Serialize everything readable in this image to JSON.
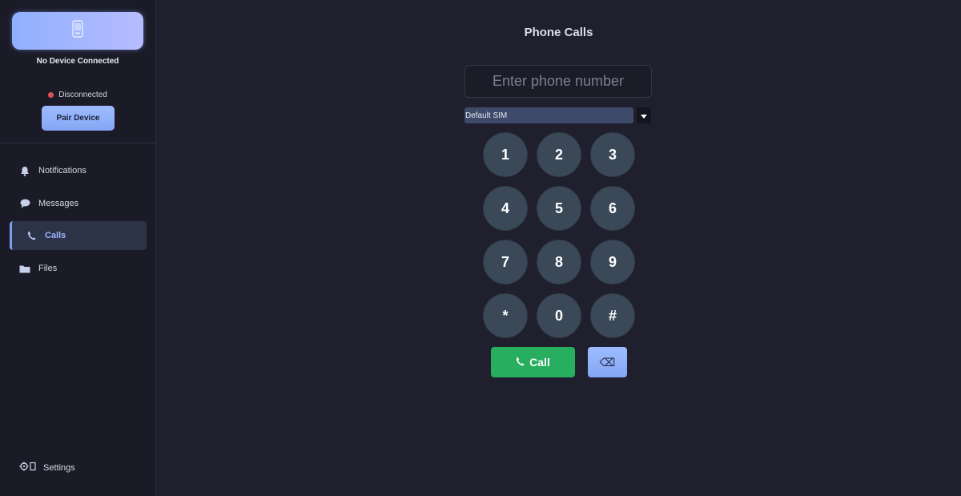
{
  "sidebar": {
    "device_name": "No Device Connected",
    "status_text": "Disconnected",
    "status_color": "#e0505a",
    "pair_button": "Pair Device",
    "items": [
      {
        "label": "Notifications",
        "icon": "bell-icon"
      },
      {
        "label": "Messages",
        "icon": "chat-bubble-icon"
      },
      {
        "label": "Calls",
        "icon": "phone-icon",
        "active": true
      },
      {
        "label": "Files",
        "icon": "folder-icon"
      }
    ],
    "settings_label": "Settings"
  },
  "main": {
    "title": "Phone Calls",
    "phone_input": {
      "placeholder": "Enter phone number",
      "value": ""
    },
    "sim_select": {
      "selected": "Default SIM"
    },
    "keypad": [
      "1",
      "2",
      "3",
      "4",
      "5",
      "6",
      "7",
      "8",
      "9",
      "*",
      "0",
      "#"
    ],
    "call_button": "Call",
    "backspace_symbol": "⌫"
  },
  "colors": {
    "accent": "#8fb0ff",
    "call_green": "#27ae5f",
    "key_bg": "#3a4858",
    "background": "#1f1f2d"
  }
}
